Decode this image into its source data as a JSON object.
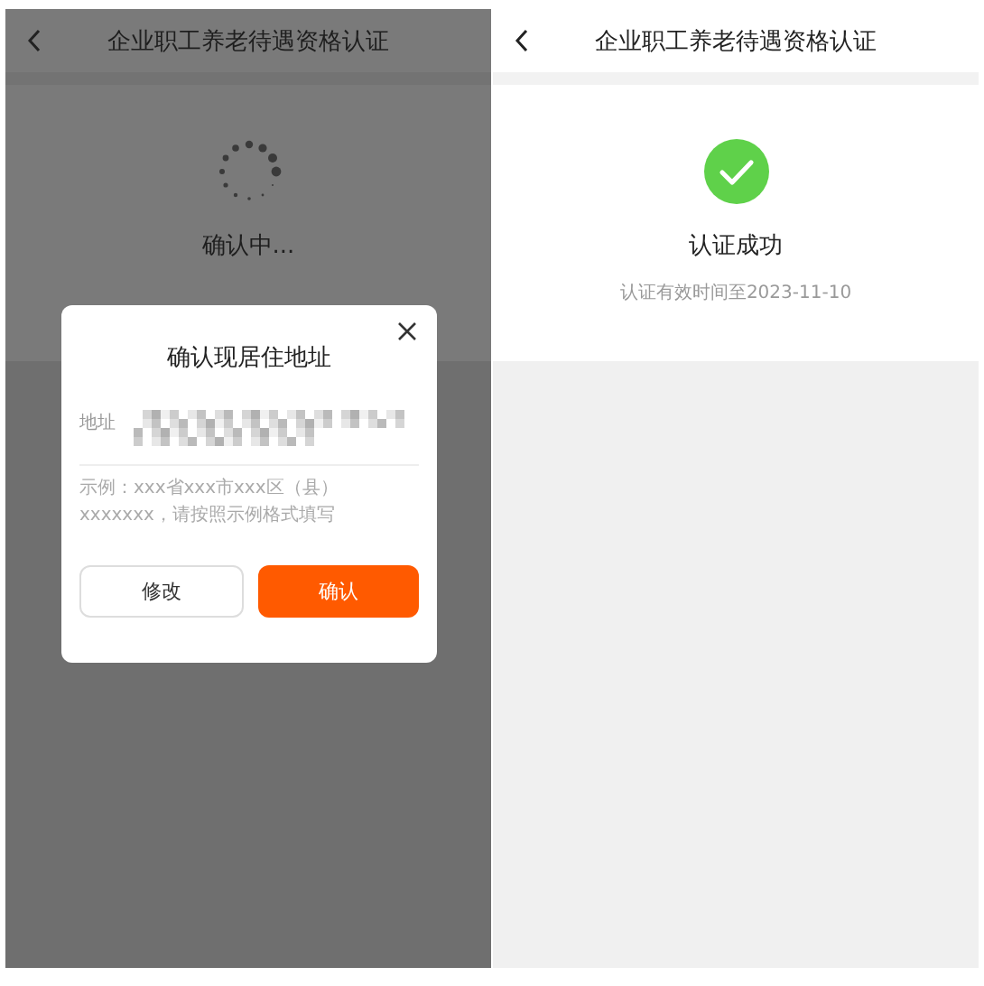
{
  "left_screen": {
    "title": "企业职工养老待遇资格认证",
    "status": "确认中...",
    "dialog": {
      "title": "确认现居住地址",
      "field_label": "地址",
      "hint": "示例：xxx省xxx市xxx区（县）xxxxxxx，请按照示例格式填写",
      "buttons": [
        {
          "label": "修改",
          "kind": "secondary"
        },
        {
          "label": "确认",
          "kind": "primary"
        }
      ]
    }
  },
  "right_screen": {
    "title": "企业职工养老待遇资格认证",
    "result": "认证成功",
    "validity": "认证有效时间至2023-11-10"
  }
}
